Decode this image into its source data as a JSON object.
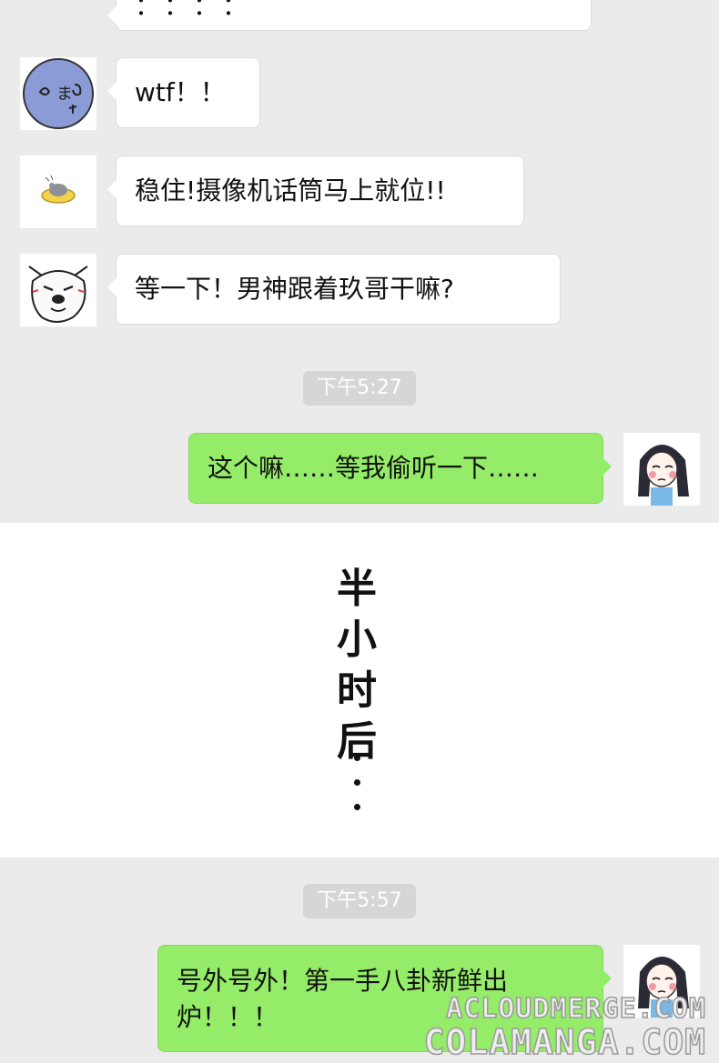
{
  "messages": [
    {
      "text": "：：：：",
      "direction": "in",
      "avatar": "blank"
    },
    {
      "text": "wtf！！",
      "direction": "in",
      "avatar": "blue-face-avatar"
    },
    {
      "text": "稳住!摄像机话筒马上就位!!",
      "direction": "in",
      "avatar": "mouse-on-plate-avatar"
    },
    {
      "text": "等一下！男神跟着玖哥干嘛?",
      "direction": "in",
      "avatar": "husky-dog-avatar"
    },
    {
      "timestamp": "下午5:27"
    },
    {
      "text": "这个嘛……等我偷听一下……",
      "direction": "out",
      "avatar": "girl-avatar"
    },
    {
      "timestamp": "下午5:57"
    },
    {
      "text_line1": "号外号外！第一手八卦新鲜出",
      "text_line2": "炉！！！",
      "direction": "out",
      "avatar": "girl-avatar"
    }
  ],
  "interlude": {
    "chars": [
      "半",
      "小",
      "时",
      "后"
    ]
  },
  "watermark": {
    "line1": "ACLOUDMERGE.COM",
    "line2": "COLAMANGA.COM"
  },
  "colors": {
    "incoming_bubble": "#ffffff",
    "outgoing_bubble": "#95ec69",
    "background": "#ebebeb",
    "timestamp_bg": "#d6d6d6"
  }
}
